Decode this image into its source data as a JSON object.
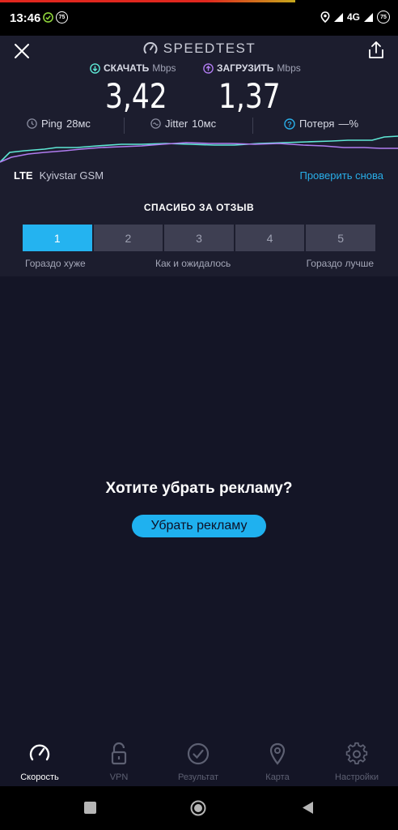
{
  "status": {
    "time": "13:46",
    "badge": "75",
    "network": "4G",
    "battery": "75"
  },
  "header": {
    "brand": "SPEEDTEST",
    "close_icon": "close-icon",
    "share_icon": "share-icon"
  },
  "results": {
    "download_label": "СКАЧАТЬ",
    "download_unit": "Mbps",
    "download_value": "3,42",
    "upload_label": "ЗАГРУЗИТЬ",
    "upload_unit": "Mbps",
    "upload_value": "1,37",
    "ping_label": "Ping",
    "ping_value": "28мс",
    "jitter_label": "Jitter",
    "jitter_value": "10мс",
    "loss_label": "Потеря",
    "loss_value": "—%"
  },
  "connection": {
    "type": "LTE",
    "carrier": "Kyivstar GSM",
    "retest": "Проверить снова"
  },
  "feedback": {
    "title": "СПАСИБО ЗА ОТЗЫВ",
    "options": [
      "1",
      "2",
      "3",
      "4",
      "5"
    ],
    "selected": "1",
    "label_low": "Гораздо хуже",
    "label_mid": "Как и ожидалось",
    "label_high": "Гораздо лучше"
  },
  "ad": {
    "title": "Хотите убрать рекламу?",
    "button": "Убрать рекламу"
  },
  "tabs": [
    {
      "label": "Скорость",
      "icon": "speedometer-icon",
      "active": true
    },
    {
      "label": "VPN",
      "icon": "lock-icon",
      "active": false
    },
    {
      "label": "Результат",
      "icon": "checkmark-icon",
      "active": false
    },
    {
      "label": "Карта",
      "icon": "map-pin-icon",
      "active": false
    },
    {
      "label": "Настройки",
      "icon": "gear-icon",
      "active": false
    }
  ],
  "colors": {
    "download": "#5ee8d5",
    "upload": "#b07cf0",
    "accent": "#24b3f0",
    "panel": "#1c1d2e",
    "background": "#141526"
  }
}
